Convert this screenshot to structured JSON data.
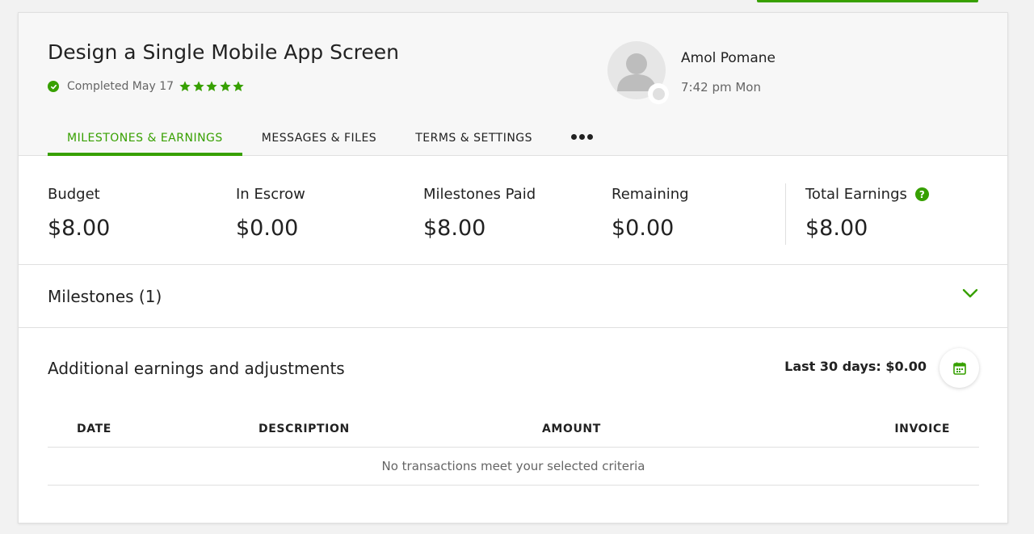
{
  "job": {
    "title": "Design a Single Mobile App Screen",
    "status": "Completed May 17",
    "rating_stars": 5
  },
  "client": {
    "name": "Amol Pomane",
    "local_time": "7:42 pm Mon"
  },
  "tabs": [
    {
      "label": "MILESTONES & EARNINGS",
      "active": true
    },
    {
      "label": "MESSAGES & FILES",
      "active": false
    },
    {
      "label": "TERMS & SETTINGS",
      "active": false
    }
  ],
  "summary": {
    "budget": {
      "label": "Budget",
      "value": "$8.00"
    },
    "escrow": {
      "label": "In Escrow",
      "value": "$0.00"
    },
    "paid": {
      "label": "Milestones Paid",
      "value": "$8.00"
    },
    "remaining": {
      "label": "Remaining",
      "value": "$0.00"
    },
    "total": {
      "label": "Total Earnings",
      "value": "$8.00"
    }
  },
  "milestones": {
    "title": "Milestones (1)"
  },
  "additional": {
    "title": "Additional earnings and adjustments",
    "last30": "Last 30 days: $0.00",
    "columns": [
      "DATE",
      "DESCRIPTION",
      "AMOUNT",
      "INVOICE"
    ],
    "empty_message": "No transactions meet your selected criteria"
  },
  "colors": {
    "accent": "#37a000",
    "text": "#222222",
    "muted": "#656565",
    "border": "#e0e0e0"
  },
  "icons": [
    "check-circle-icon",
    "star-icon",
    "avatar-icon",
    "more-icon",
    "help-icon",
    "chevron-down-icon",
    "calendar-icon"
  ]
}
